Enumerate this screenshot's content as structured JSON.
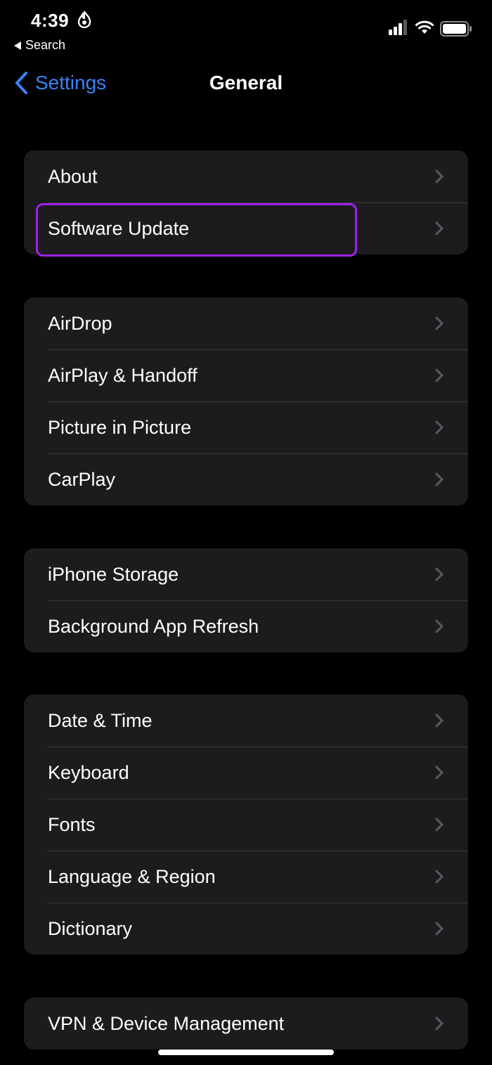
{
  "status_bar": {
    "time": "4:39",
    "back_app_label": "Search"
  },
  "nav": {
    "back_label": "Settings",
    "title": "General"
  },
  "groups": [
    {
      "items": [
        {
          "label": "About"
        },
        {
          "label": "Software Update"
        }
      ]
    },
    {
      "items": [
        {
          "label": "AirDrop"
        },
        {
          "label": "AirPlay & Handoff"
        },
        {
          "label": "Picture in Picture"
        },
        {
          "label": "CarPlay"
        }
      ]
    },
    {
      "items": [
        {
          "label": "iPhone Storage"
        },
        {
          "label": "Background App Refresh"
        }
      ]
    },
    {
      "items": [
        {
          "label": "Date & Time"
        },
        {
          "label": "Keyboard"
        },
        {
          "label": "Fonts"
        },
        {
          "label": "Language & Region"
        },
        {
          "label": "Dictionary"
        }
      ]
    },
    {
      "items": [
        {
          "label": "VPN & Device Management"
        }
      ]
    }
  ],
  "colors": {
    "background": "#000000",
    "group_background": "#1c1c1e",
    "accent": "#3a82f7",
    "highlight": "#a020f0"
  },
  "icons": {
    "back": "chevron-left-icon",
    "row_disclosure": "chevron-right-icon",
    "status": [
      "hotspot-icon",
      "signal-icon",
      "wifi-icon",
      "battery-icon"
    ]
  }
}
